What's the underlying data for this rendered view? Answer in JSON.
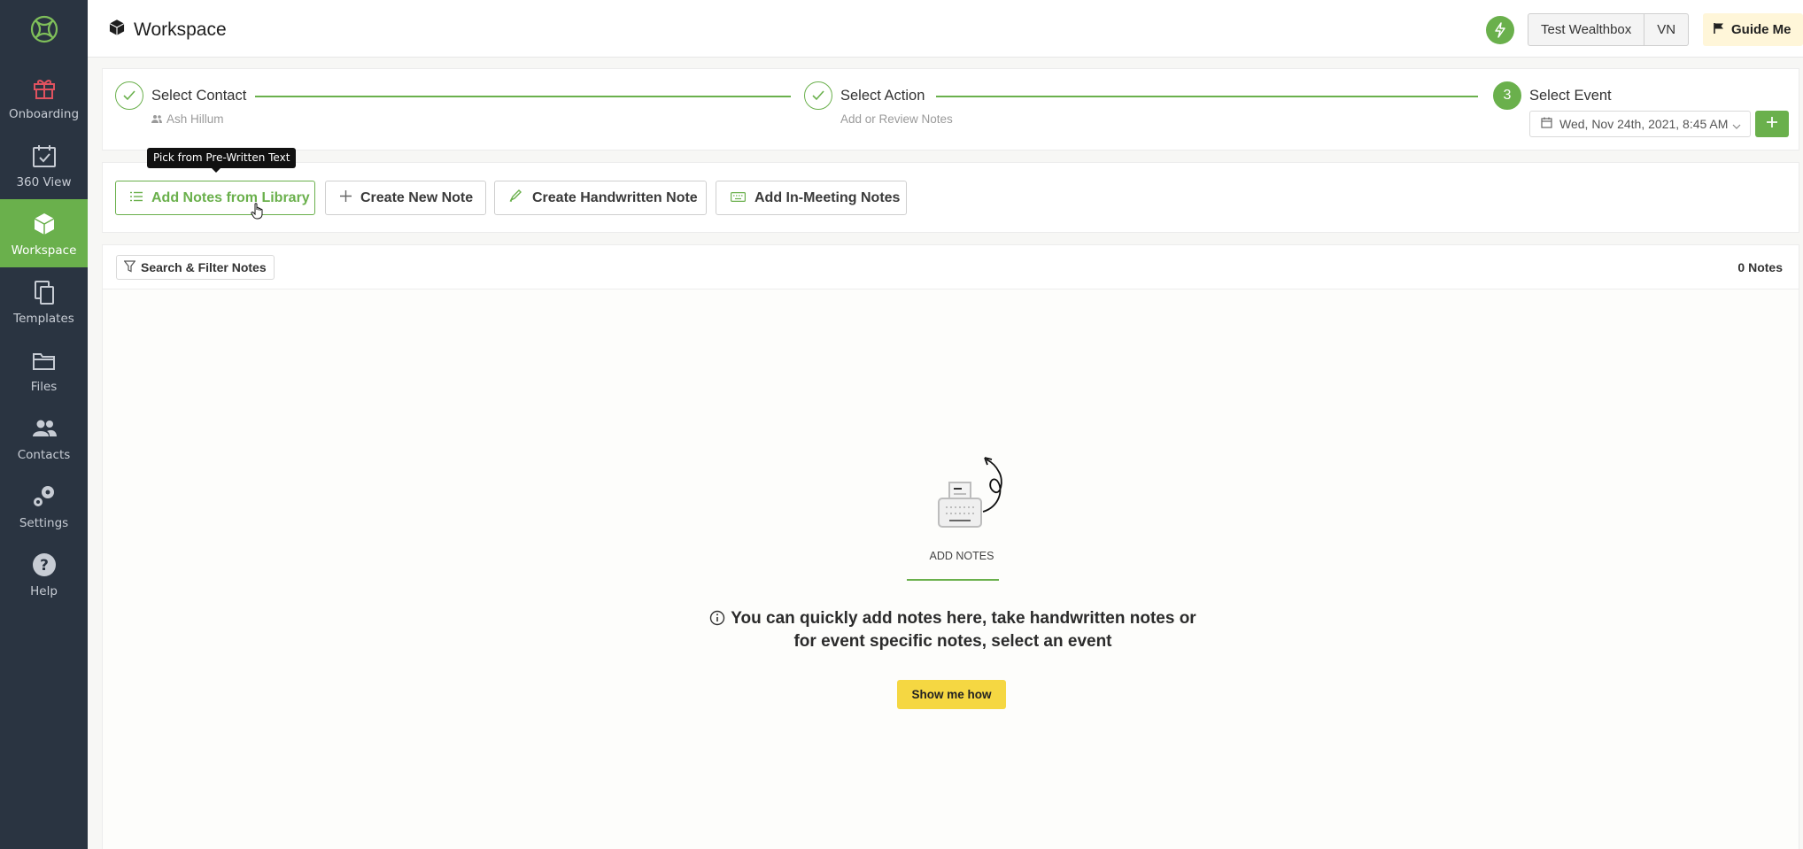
{
  "sidebar": {
    "items": [
      {
        "label": "Onboarding",
        "icon": "gift-icon",
        "active": false
      },
      {
        "label": "360 View",
        "icon": "calendar-check-icon",
        "active": false
      },
      {
        "label": "Workspace",
        "icon": "cube-icon",
        "active": true
      },
      {
        "label": "Templates",
        "icon": "copy-icon",
        "active": false
      },
      {
        "label": "Files",
        "icon": "folder-icon",
        "active": false
      },
      {
        "label": "Contacts",
        "icon": "users-icon",
        "active": false
      },
      {
        "label": "Settings",
        "icon": "gears-icon",
        "active": false
      },
      {
        "label": "Help",
        "icon": "question-circle-icon",
        "active": false
      }
    ]
  },
  "header": {
    "title": "Workspace",
    "account_label": "Test Wealthbox",
    "user_initials": "VN",
    "guide_label": "Guide Me"
  },
  "stepper": {
    "steps": [
      {
        "title": "Select Contact",
        "subtitle": "Ash Hillum",
        "state": "done"
      },
      {
        "title": "Select Action",
        "subtitle": "Add or Review Notes",
        "state": "done"
      },
      {
        "title": "Select Event",
        "number": "3",
        "state": "current"
      }
    ],
    "event_date": "Wed, Nov 24th, 2021, 8:45 AM"
  },
  "tooltip": "Pick from Pre-Written Text",
  "toolbar": {
    "add_library": "Add Notes from Library",
    "create_new": "Create New Note",
    "create_handwritten": "Create Handwritten Note",
    "add_in_meeting": "Add In-Meeting Notes"
  },
  "notes": {
    "filter_label": "Search & Filter Notes",
    "count_label": "0 Notes",
    "empty_label": "ADD NOTES",
    "empty_message_line1": "You can quickly add notes here, take handwritten notes or",
    "empty_message_line2": "for event specific notes, select an event",
    "show_me_label": "Show me how"
  },
  "colors": {
    "accent": "#6ab04c",
    "sidebar_bg": "#2a3441",
    "cta_yellow": "#f5d742"
  }
}
